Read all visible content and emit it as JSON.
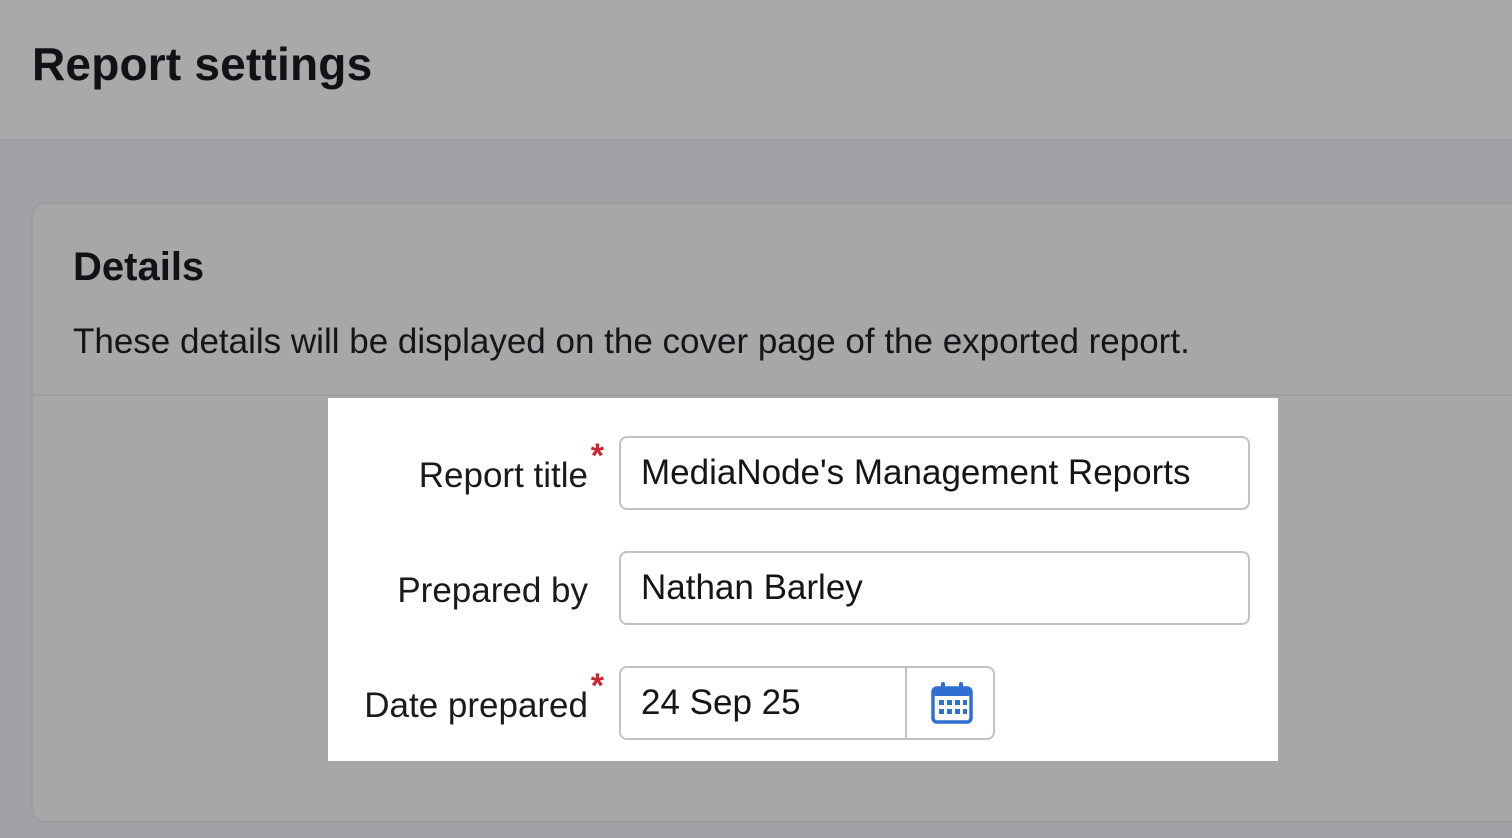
{
  "header": {
    "title": "Report settings"
  },
  "details": {
    "title": "Details",
    "description": "These details will be displayed on the cover page of the exported report.",
    "required_marker": "*",
    "fields": {
      "report_title": {
        "label": "Report title",
        "value": "MediaNode's Management Reports",
        "required": true
      },
      "prepared_by": {
        "label": "Prepared by",
        "value": "Nathan Barley",
        "required": false
      },
      "date_prepared": {
        "label": "Date prepared",
        "value": "24 Sep 25",
        "required": true,
        "icon": "calendar-icon"
      }
    }
  },
  "colors": {
    "required": "#c9252b",
    "calendar_icon": "#2f6fd2",
    "overlay_background": "#a1a2a5",
    "highlight_background": "#ffffff"
  }
}
